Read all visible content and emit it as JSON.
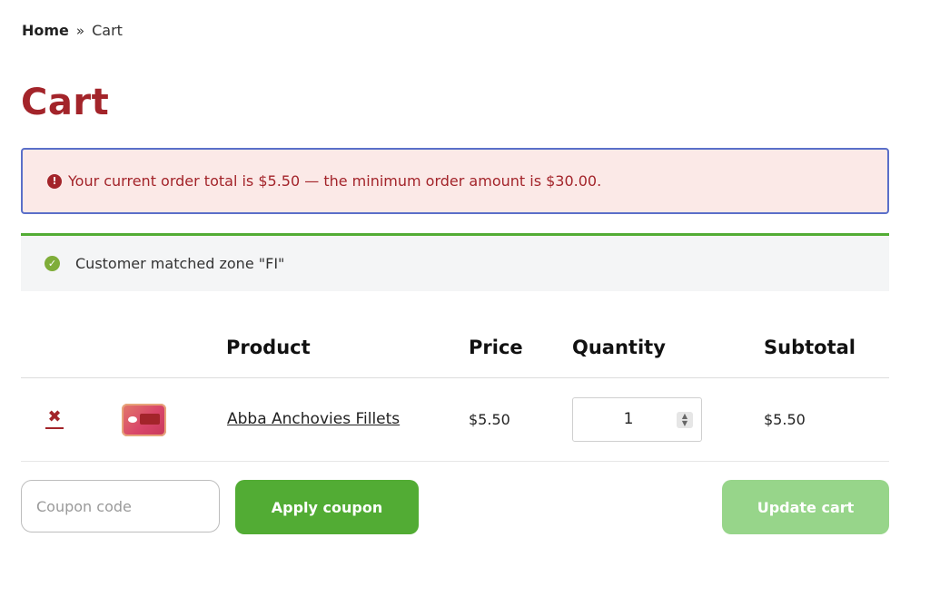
{
  "breadcrumb": {
    "home": "Home",
    "separator": "»",
    "current": "Cart"
  },
  "page": {
    "title": "Cart"
  },
  "notices": {
    "error": {
      "icon": "exclamation-circle-icon",
      "message": "Your current order total is $5.50 — the minimum order amount is $30.00.",
      "color": "#a3242a"
    },
    "info": {
      "icon": "check-circle-icon",
      "message": "Customer matched zone \"FI\"",
      "color": "#7fad39"
    }
  },
  "table": {
    "headers": {
      "product": "Product",
      "price": "Price",
      "quantity": "Quantity",
      "subtotal": "Subtotal"
    },
    "items": [
      {
        "remove_icon": "remove-x-icon",
        "thumbnail": "product-thumbnail",
        "name": "Abba Anchovies Fillets",
        "price": "$5.50",
        "quantity": "1",
        "subtotal": "$5.50"
      }
    ]
  },
  "actions": {
    "coupon_placeholder": "Coupon code",
    "coupon_value": "",
    "apply_label": "Apply coupon",
    "update_label": "Update cart"
  },
  "colors": {
    "accent": "#a3242a",
    "primary_button": "#52ac34",
    "disabled_button": "#97d58a",
    "error_border": "#5a6fc9"
  }
}
